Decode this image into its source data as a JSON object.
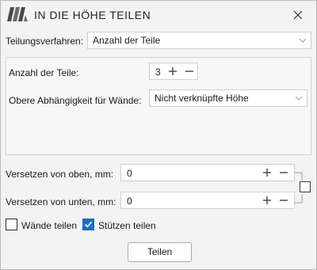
{
  "window": {
    "title": "IN DIE HÖHE TEILEN",
    "logo_icon": "autodesk-style-logo",
    "close_icon": "close-icon"
  },
  "division": {
    "label": "Teilungsverfahren:",
    "selected": "Anzahl der Teile"
  },
  "parts": {
    "label": "Anzahl der Teile:",
    "value": "3"
  },
  "dependency": {
    "label": "Obere Abhängigkeit für Wände:",
    "selected": "Nicht verknüpfte Höhe"
  },
  "offset_top": {
    "label": "Versetzen von oben, mm:",
    "value": "0"
  },
  "offset_bottom": {
    "label": "Versetzen von unten, mm:",
    "value": "0"
  },
  "options": {
    "split_walls": {
      "label": "Wände teilen",
      "checked": false
    },
    "split_columns": {
      "label": "Stützen teilen",
      "checked": true
    }
  },
  "actions": {
    "submit": "Teilen"
  },
  "colors": {
    "accent": "#1a6fc2",
    "dialog_bg": "#f3f3f3",
    "border": "#cfcfcf"
  }
}
